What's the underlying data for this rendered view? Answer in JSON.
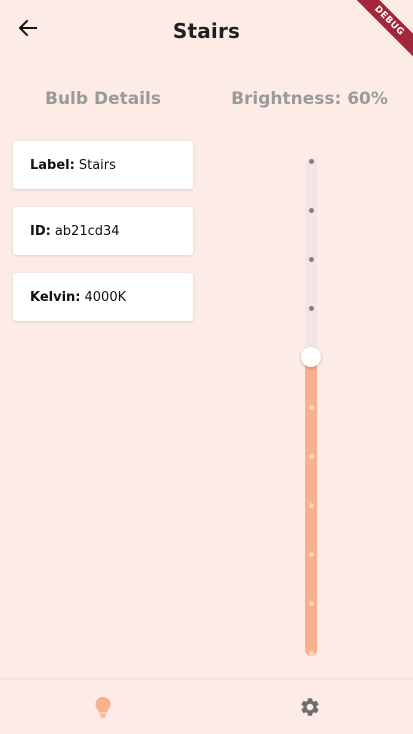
{
  "appbar": {
    "title": "Stairs",
    "back_icon": "arrow-left-icon"
  },
  "debug_banner": "DEBUG",
  "sections": {
    "left_title": "Bulb Details",
    "right_title": "Brightness: 60%"
  },
  "details": [
    {
      "key": "Label:",
      "value": "Stairs"
    },
    {
      "key": "ID:",
      "value": "ab21cd34"
    },
    {
      "key": "Kelvin:",
      "value": "4000K"
    }
  ],
  "brightness": {
    "value": 0.6
  },
  "bottom_nav": {
    "items": [
      {
        "icon": "lightbulb-icon",
        "active": true
      },
      {
        "icon": "gear-icon",
        "active": false
      }
    ]
  },
  "colors": {
    "background": "#fdece6",
    "accent": "#f9b08f",
    "debug": "#a3263a"
  }
}
